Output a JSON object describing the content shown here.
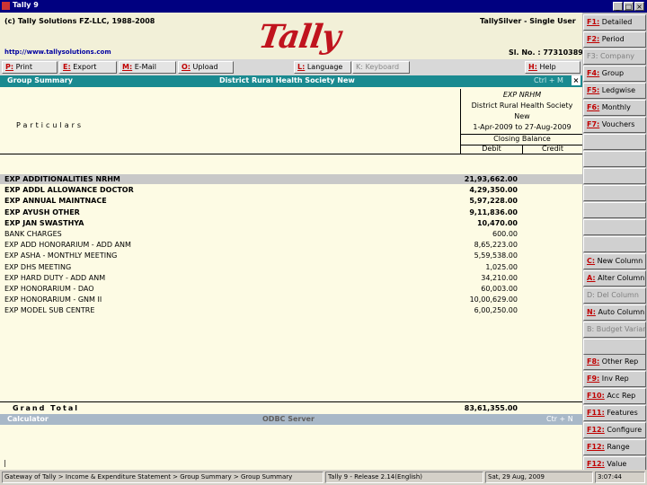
{
  "window": {
    "title": "Tally 9"
  },
  "header": {
    "copyright": "(c) Tally Solutions FZ-LLC, 1988-2008",
    "product": "TallySilver - Single User",
    "url": "http://www.tallysolutions.com",
    "serial": "Sl. No. : 773103897",
    "logo": "Tally"
  },
  "menu": [
    {
      "key": "P:",
      "label": "Print",
      "enabled": true
    },
    {
      "key": "E:",
      "label": "Export",
      "enabled": true
    },
    {
      "key": "M:",
      "label": "E-Mail",
      "enabled": true
    },
    {
      "key": "O:",
      "label": "Upload",
      "enabled": true
    },
    {
      "key": "L:",
      "label": "Language",
      "enabled": true
    },
    {
      "key": "K:",
      "label": "Keyboard",
      "enabled": false
    },
    {
      "key": "H:",
      "label": "Help",
      "enabled": true
    }
  ],
  "report": {
    "title": "Group Summary",
    "company": "District Rural Health Society New",
    "shortcut": "Ctrl + M",
    "particulars_label": "Particulars",
    "col_group": "EXP NRHM",
    "col_company_line1": "District Rural Health Society",
    "col_company_line2": "New",
    "col_period": "1-Apr-2009 to 27-Aug-2009",
    "col_balance": "Closing Balance",
    "col_debit": "Debit",
    "col_credit": "Credit",
    "rows": [
      {
        "name": "EXP ADDITIONALITIES NRHM",
        "debit": "21,93,662.00",
        "bold": true,
        "selected": true
      },
      {
        "name": "EXP ADDL ALLOWANCE DOCTOR",
        "debit": "4,29,350.00",
        "bold": true
      },
      {
        "name": "EXP ANNUAL MAINTNACE",
        "debit": "5,97,228.00",
        "bold": true
      },
      {
        "name": "EXP AYUSH OTHER",
        "debit": "9,11,836.00",
        "bold": true
      },
      {
        "name": "EXP JAN SWASTHYA",
        "debit": "10,470.00",
        "bold": true
      },
      {
        "name": "BANK CHARGES",
        "debit": "600.00",
        "bold": false
      },
      {
        "name": "EXP ADD HONORARIUM - ADD ANM",
        "debit": "8,65,223.00",
        "bold": false
      },
      {
        "name": "EXP ASHA - MONTHLY MEETING",
        "debit": "5,59,538.00",
        "bold": false
      },
      {
        "name": "EXP DHS MEETING",
        "debit": "1,025.00",
        "bold": false
      },
      {
        "name": "EXP HARD DUTY - ADD ANM",
        "debit": "34,210.00",
        "bold": false
      },
      {
        "name": "EXP HONORARIUM - DAO",
        "debit": "60,003.00",
        "bold": false
      },
      {
        "name": "EXP HONORARIUM - GNM II",
        "debit": "10,00,629.00",
        "bold": false
      },
      {
        "name": "EXP MODEL SUB CENTRE",
        "debit": "6,00,250.00",
        "bold": false
      }
    ],
    "total_label": "Grand Total",
    "total_debit": "83,61,355.00"
  },
  "calculator": {
    "label": "Calculator",
    "server": "ODBC Server",
    "shortcut": "Ctr + N"
  },
  "status": {
    "path": "Gateway of Tally > Income & Expenditure Statement > Group Summary > Group Summary",
    "release": "Tally 9 - Release 2.14(English)",
    "date": "Sat, 29 Aug, 2009",
    "time": "3:07:44"
  },
  "side_buttons": [
    {
      "key": "F1:",
      "label": "Detailed",
      "enabled": true
    },
    {
      "key": "F2:",
      "label": "Period",
      "enabled": true
    },
    {
      "key": "F3:",
      "label": "Company",
      "enabled": false
    },
    {
      "key": "F4:",
      "label": "Group",
      "enabled": true
    },
    {
      "key": "F5:",
      "label": "Ledgwise",
      "enabled": true
    },
    {
      "key": "F6:",
      "label": "Monthly",
      "enabled": true
    },
    {
      "key": "F7:",
      "label": "Vouchers",
      "enabled": true
    },
    {
      "key": "C:",
      "label": "New Column",
      "enabled": true
    },
    {
      "key": "A:",
      "label": "Alter Column",
      "enabled": true
    },
    {
      "key": "D:",
      "label": "Del Column",
      "enabled": false
    },
    {
      "key": "N:",
      "label": "Auto Column",
      "enabled": true
    },
    {
      "key": "B:",
      "label": "Budget Variance",
      "enabled": false
    },
    {
      "key": "F8:",
      "label": "Other Rep",
      "enabled": true
    },
    {
      "key": "F9:",
      "label": "Inv Rep",
      "enabled": true
    },
    {
      "key": "F10:",
      "label": "Acc Rep",
      "enabled": true
    },
    {
      "key": "F11:",
      "label": "Features",
      "enabled": true
    },
    {
      "key": "F12:",
      "label": "Configure",
      "enabled": true
    },
    {
      "key": "F12:",
      "label": "Range",
      "enabled": true
    },
    {
      "key": "F12:",
      "label": "Value",
      "enabled": true
    }
  ]
}
